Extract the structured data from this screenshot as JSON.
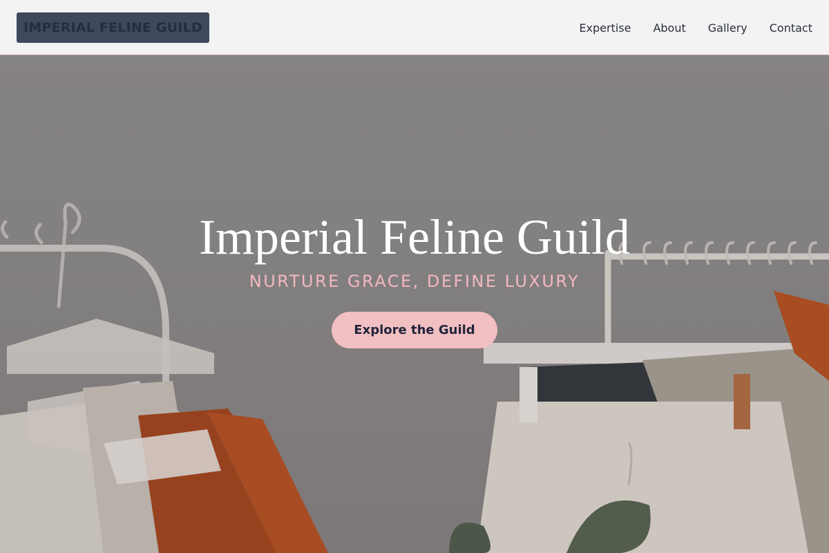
{
  "header": {
    "logo_text": "IMPERIAL FELINE GUILD",
    "nav": [
      {
        "label": "Expertise"
      },
      {
        "label": "About"
      },
      {
        "label": "Gallery"
      },
      {
        "label": "Contact"
      }
    ]
  },
  "hero": {
    "title": "Imperial Feline Guild",
    "tagline": "NURTURE GRACE, DEFINE LUXURY",
    "cta_label": "Explore the Guild",
    "background_image": "clothing-rack-photo"
  },
  "colors": {
    "header_bg": "#f3f3f4",
    "logo_bg": "#3e4a5c",
    "tagline": "#f2b8be",
    "cta_bg": "#f2bfc2",
    "cta_text": "#20243a"
  }
}
